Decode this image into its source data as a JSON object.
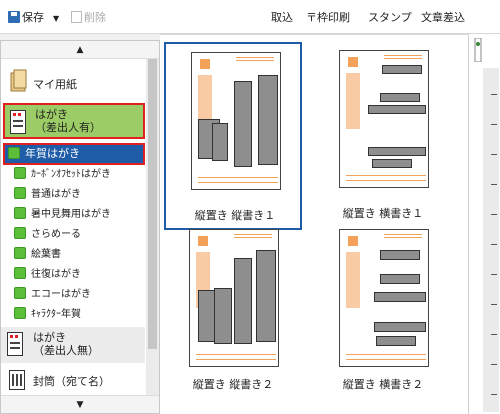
{
  "toolbar": {
    "save": "保存",
    "delete": "削除",
    "import": "取込",
    "frame_print": "〒枠印刷",
    "stamp": "スタンプ",
    "text_insert": "文章差込"
  },
  "sidebar": {
    "category_my_paper": "マイ用紙",
    "category_hagaki_sender": "はがき\n（差出人有）",
    "items": [
      "年賀はがき",
      "ｶｰﾎﾞﾝｵﾌｾｯﾄはがき",
      "普通はがき",
      "暑中見舞用はがき",
      "さらめーる",
      "絵葉書",
      "往復はがき",
      "エコーはがき",
      "ｷｬﾗｸﾀｰ年賀"
    ],
    "category_hagaki_nosender": "はがき\n（差出人無）",
    "category_envelope": "封筒（宛て名）"
  },
  "layouts": [
    {
      "caption": "縦置き 縦書き１"
    },
    {
      "caption": "縦置き 横書き１"
    },
    {
      "caption": "縦置き 縦書き２"
    },
    {
      "caption": "縦置き 横書き２"
    }
  ],
  "colors": {
    "selection": "#1f5ca8",
    "highlight_green": "#9ccc65",
    "red_outline": "#e02020",
    "postcard_orange": "#f4a15a"
  }
}
